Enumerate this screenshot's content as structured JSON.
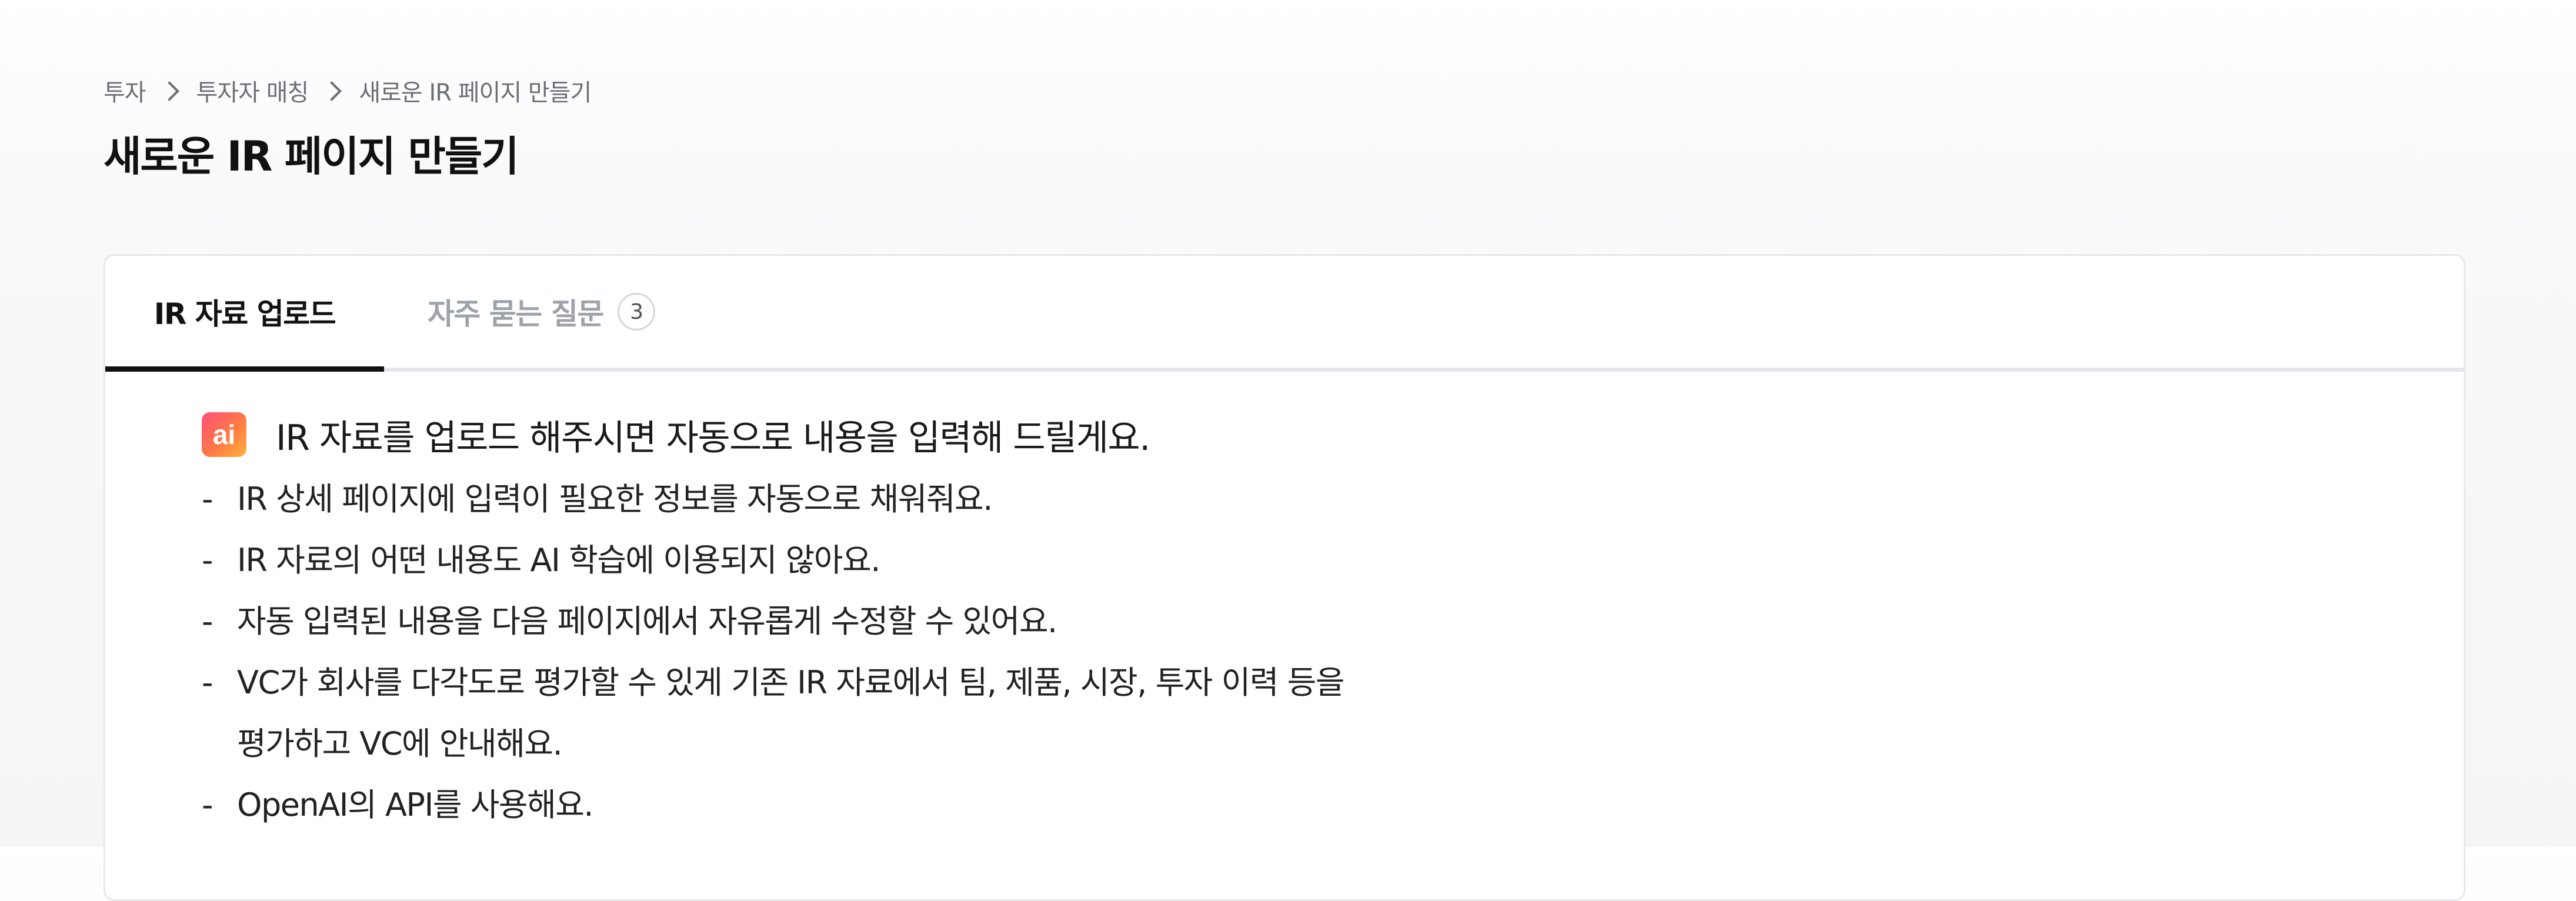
{
  "breadcrumb": {
    "items": [
      "투자",
      "투자자 매칭",
      "새로운 IR 페이지 만들기"
    ]
  },
  "page": {
    "title": "새로운 IR 페이지 만들기"
  },
  "tabs": [
    {
      "label": "IR 자료 업로드",
      "active": true
    },
    {
      "label": "자주 묻는 질문",
      "count": "3",
      "active": false
    }
  ],
  "upload": {
    "badge": "ai",
    "headline": "IR 자료를 업로드 해주시면 자동으로 내용을 입력해 드릴게요.",
    "bullets": [
      "IR 상세 페이지에 입력이 필요한 정보를 자동으로 채워줘요.",
      "IR 자료의 어떤 내용도 AI 학습에 이용되지 않아요.",
      "자동 입력된 내용을 다음 페이지에서 자유롭게 수정할 수 있어요.",
      "VC가 회사를 다각도로 평가할 수 있게 기존 IR 자료에서 팀, 제품, 시장, 투자 이력 등을",
      "평가하고 VC에 안내해요.",
      "OpenAI의 API를 사용해요."
    ]
  },
  "colors": {
    "badge_gradient_start": "#ff4f7a",
    "badge_gradient_end": "#ffb13a",
    "active_tab_underline": "#111111",
    "inactive_tab_text": "#9ea3aa"
  }
}
